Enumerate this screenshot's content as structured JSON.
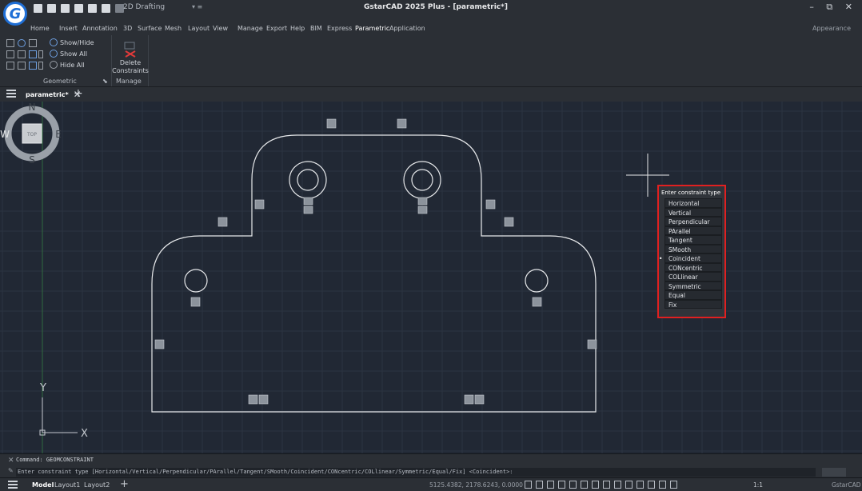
{
  "app": {
    "logo_letter": "G",
    "workspace": "2D Drafting",
    "title": "GstarCAD 2025 Plus - [parametric*]",
    "window_controls": "– ⧉ ✕",
    "appearance": "Appearance"
  },
  "ribbon": {
    "tabs": [
      "Home",
      "Insert",
      "Annotation",
      "3D",
      "Surface",
      "Mesh",
      "Layout",
      "View",
      "Manage",
      "Export",
      "Help",
      "BIM",
      "Express",
      "Parametric",
      "Application"
    ],
    "active_tab": "Parametric",
    "geometric_panel": {
      "label": "Geometric",
      "show_hide": "Show/Hide",
      "show_all": "Show All",
      "hide_all": "Hide All"
    },
    "manage_panel": {
      "label": "Manage",
      "delete_constraints": "Delete Constraints"
    }
  },
  "document": {
    "tab_label": "parametric*",
    "close_glyph": "✕",
    "new_tab_glyph": "+"
  },
  "constraint_menu": {
    "title": "Enter constraint type",
    "items": [
      "Horizontal",
      "Vertical",
      "Perpendicular",
      "PArallel",
      "Tangent",
      "SMooth",
      "Coincident",
      "CONcentric",
      "COLlinear",
      "Symmetric",
      "Equal",
      "Fix"
    ],
    "selected": "Coincident"
  },
  "viewcube": {
    "north": "N",
    "south": "S",
    "east": "E",
    "west": "W",
    "face": "TOP"
  },
  "ucs": {
    "x_label": "X",
    "y_label": "Y"
  },
  "command": {
    "line1": "Command: GEOMCONSTRAINT",
    "line2": "Enter constraint type [Horizontal/Vertical/Perpendicular/PArallel/Tangent/SMooth/Coincident/CONcentric/COLlinear/Symmetric/Equal/Fix] <Coincident>:"
  },
  "status": {
    "layouts": [
      "Model",
      "Layout1",
      "Layout2"
    ],
    "active_layout": "Model",
    "coordinates": "5125.4382, 2178.6243, 0.0000",
    "scale": "1:1",
    "app_name": "GstarCAD"
  },
  "colors": {
    "background": "#212834",
    "grid": "#2c3442",
    "geometry": "#e6e8ea",
    "highlight": "#e02020",
    "ucs_green": "#3fae5a"
  }
}
